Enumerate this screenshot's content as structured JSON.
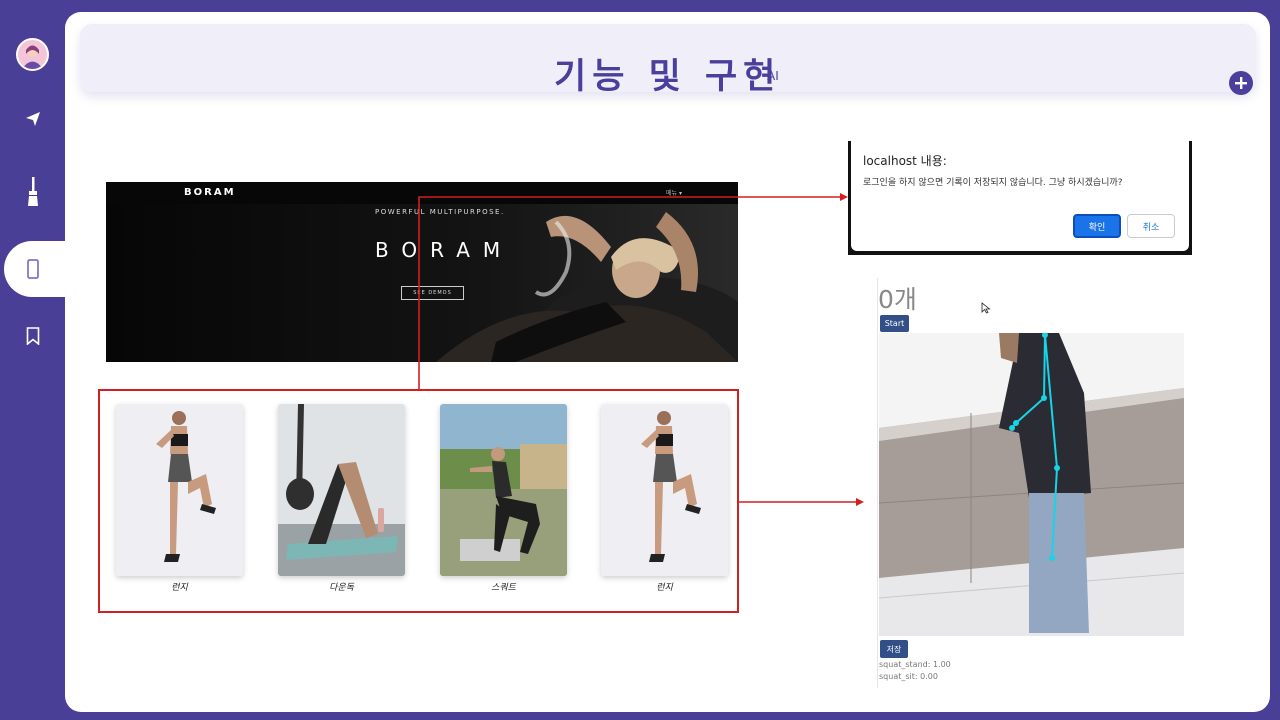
{
  "header": {
    "title": "기능 및 구현",
    "subtitle": "AI"
  },
  "sidebar": {
    "items": [
      {
        "icon": "paper-plane-icon"
      },
      {
        "icon": "paintbrush-icon"
      },
      {
        "icon": "mobile-icon",
        "active": true
      },
      {
        "icon": "bookmark-icon"
      }
    ]
  },
  "boram": {
    "logo": "BORAM",
    "menu": "메뉴 ▾",
    "tagline": "POWERFUL MULTIPURPOSE.",
    "hero": "BORAM",
    "button": "SEE DEMOS"
  },
  "exercises": [
    {
      "label": "런지"
    },
    {
      "label": "다운독"
    },
    {
      "label": "스쿼트"
    },
    {
      "label": "런지"
    }
  ],
  "alert": {
    "title": "localhost 내용:",
    "message": "로그인을 하지 않으면 기록이 저장되지 않습니다. 그냥 하시겠습니까?",
    "ok": "확인",
    "cancel": "취소"
  },
  "pose": {
    "count": "0개",
    "start": "Start",
    "save": "저장",
    "stand": "squat_stand: 1.00",
    "sit": "squat_sit: 0.00"
  },
  "colors": {
    "accent": "#4a3f9c",
    "arrow": "#d41f1f",
    "skeleton": "#17d4e6"
  }
}
